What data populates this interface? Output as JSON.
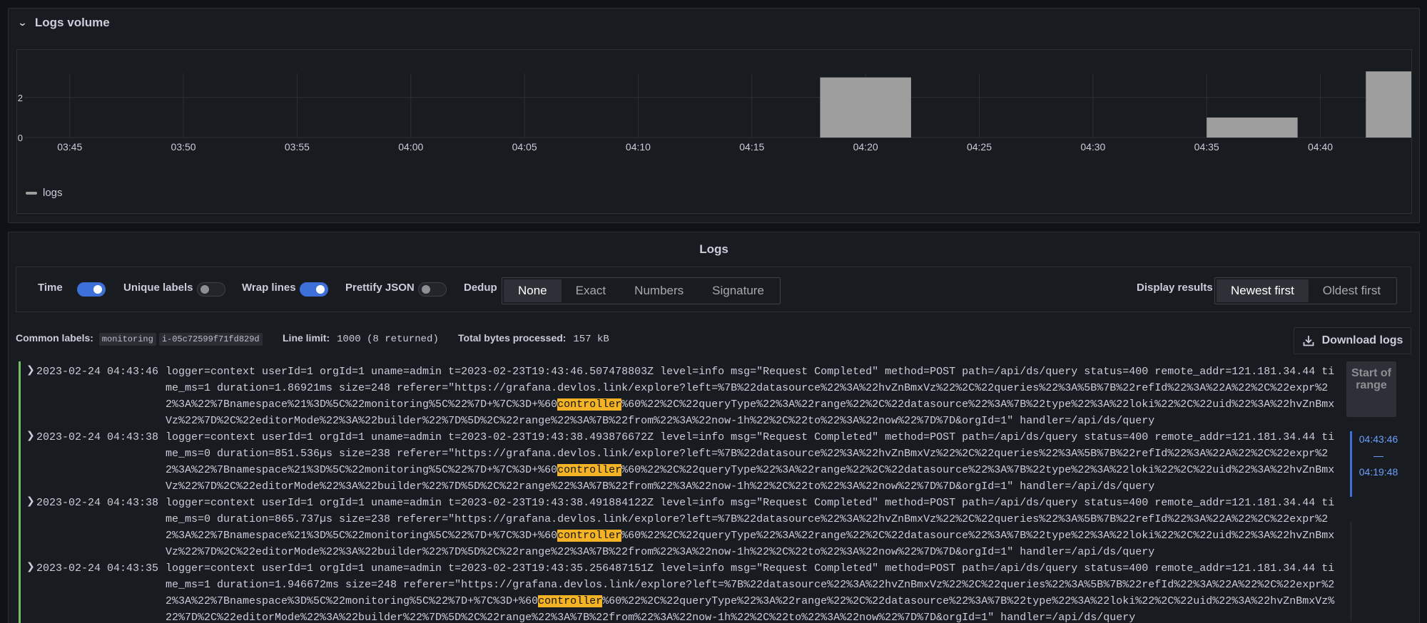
{
  "volume": {
    "title": "Logs volume",
    "legend_label": "logs",
    "series_color": "#9e9e9e"
  },
  "chart_data": {
    "type": "bar",
    "x_ticks": [
      "03:45",
      "03:50",
      "03:55",
      "04:00",
      "04:05",
      "04:10",
      "04:15",
      "04:20",
      "04:25",
      "04:30",
      "04:35",
      "04:40"
    ],
    "y_ticks": [
      "2",
      "0"
    ],
    "ylim": [
      0,
      3.2
    ],
    "xlim_minutes": [
      "03:43",
      "04:44"
    ],
    "series": [
      {
        "name": "logs",
        "points": [
          {
            "start": "04:18",
            "end": "04:22",
            "value": 3
          },
          {
            "start": "04:35",
            "end": "04:39",
            "value": 1
          },
          {
            "start": "04:42",
            "end": "04:44",
            "value": 3.3
          }
        ]
      }
    ],
    "grid": true,
    "legend": "bottom-left"
  },
  "logs": {
    "title": "Logs",
    "options": {
      "time_label": "Time",
      "time_on": true,
      "unique_labels_label": "Unique labels",
      "unique_labels_on": false,
      "wrap_lines_label": "Wrap lines",
      "wrap_lines_on": true,
      "prettify_json_label": "Prettify JSON",
      "prettify_json_on": false,
      "dedup_label": "Dedup",
      "dedup_options": [
        "None",
        "Exact",
        "Numbers",
        "Signature"
      ],
      "dedup_selected": "None",
      "display_results_label": "Display results",
      "order_options": [
        "Newest first",
        "Oldest first"
      ],
      "order_selected": "Newest first"
    },
    "meta": {
      "common_labels_label": "Common labels:",
      "common_labels": [
        "monitoring",
        "i-05c72599f71fd829d"
      ],
      "line_limit_label": "Line limit:",
      "line_limit_value": "1000 (8 returned)",
      "bytes_label": "Total bytes processed:",
      "bytes_value": "157 kB"
    },
    "download_label": "Download logs",
    "range": {
      "start_label": "Start of range",
      "segment_from": "04:43:46",
      "segment_sep": "—",
      "segment_to": "04:19:48"
    },
    "rows": [
      {
        "ts": "2023-02-24 04:43:46",
        "before": "logger=context userId=1 orgId=1 uname=admin t=2023-02-23T19:43:46.507478803Z level=info msg=\"Request Completed\" method=POST path=/api/ds/query status=400 remote_addr=121.181.34.44 time_ms=1 duration=1.86921ms size=248 referer=\"https://grafana.devlos.link/explore?left=%7B%22datasource%22%3A%22hvZnBmxVz%22%2C%22queries%22%3A%5B%7B%22refId%22%3A%22A%22%2C%22expr%22%3A%22%7Bnamespace%21%3D%5C%22monitoring%5C%22%7D+%7C%3D+%60",
        "highlight": "controller",
        "after": "%60%22%2C%22queryType%22%3A%22range%22%2C%22datasource%22%3A%7B%22type%22%3A%22loki%22%2C%22uid%22%3A%22hvZnBmxVz%22%7D%2C%22editorMode%22%3A%22builder%22%7D%5D%2C%22range%22%3A%7B%22from%22%3A%22now-1h%22%2C%22to%22%3A%22now%22%7D%7D&orgId=1\" handler=/api/ds/query"
      },
      {
        "ts": "2023-02-24 04:43:38",
        "before": "logger=context userId=1 orgId=1 uname=admin t=2023-02-23T19:43:38.493876672Z level=info msg=\"Request Completed\" method=POST path=/api/ds/query status=400 remote_addr=121.181.34.44 time_ms=0 duration=851.536µs size=238 referer=\"https://grafana.devlos.link/explore?left=%7B%22datasource%22%3A%22hvZnBmxVz%22%2C%22queries%22%3A%5B%7B%22refId%22%3A%22A%22%2C%22expr%22%3A%22%7Bnamespace%21%3D%5C%22monitoring%5C%22%7D+%7C%3D+%60",
        "highlight": "controller",
        "after": "%60%22%2C%22queryType%22%3A%22range%22%2C%22datasource%22%3A%7B%22type%22%3A%22loki%22%2C%22uid%22%3A%22hvZnBmxVz%22%7D%2C%22editorMode%22%3A%22builder%22%7D%5D%2C%22range%22%3A%7B%22from%22%3A%22now-1h%22%2C%22to%22%3A%22now%22%7D%7D&orgId=1\" handler=/api/ds/query"
      },
      {
        "ts": "2023-02-24 04:43:38",
        "before": "logger=context userId=1 orgId=1 uname=admin t=2023-02-23T19:43:38.491884122Z level=info msg=\"Request Completed\" method=POST path=/api/ds/query status=400 remote_addr=121.181.34.44 time_ms=0 duration=865.737µs size=238 referer=\"https://grafana.devlos.link/explore?left=%7B%22datasource%22%3A%22hvZnBmxVz%22%2C%22queries%22%3A%5B%7B%22refId%22%3A%22A%22%2C%22expr%22%3A%22%7Bnamespace%21%3D%5C%22monitoring%5C%22%7D+%7C%3D+%60",
        "highlight": "controller",
        "after": "%60%22%2C%22queryType%22%3A%22range%22%2C%22datasource%22%3A%7B%22type%22%3A%22loki%22%2C%22uid%22%3A%22hvZnBmxVz%22%7D%2C%22editorMode%22%3A%22builder%22%7D%5D%2C%22range%22%3A%7B%22from%22%3A%22now-1h%22%2C%22to%22%3A%22now%22%7D%7D&orgId=1\" handler=/api/ds/query"
      },
      {
        "ts": "2023-02-24 04:43:35",
        "before": "logger=context userId=1 orgId=1 uname=admin t=2023-02-23T19:43:35.256487151Z level=info msg=\"Request Completed\" method=POST path=/api/ds/query status=400 remote_addr=121.181.34.44 time_ms=1 duration=1.946672ms size=248 referer=\"https://grafana.devlos.link/explore?left=%7B%22datasource%22%3A%22hvZnBmxVz%22%2C%22queries%22%3A%5B%7B%22refId%22%3A%22A%22%2C%22expr%22%3A%22%7Bnamespace%3D%5C%22monitoring%5C%22%7D+%7C%3D+%60",
        "highlight": "controller",
        "after": "%60%22%2C%22queryType%22%3A%22range%22%2C%22datasource%22%3A%7B%22type%22%3A%22loki%22%2C%22uid%22%3A%22hvZnBmxVz%22%7D%2C%22editorMode%22%3A%22builder%22%7D%5D%2C%22range%22%3A%7B%22from%22%3A%22now-1h%22%2C%22to%22%3A%22now%22%7D%7D&orgId=1\" handler=/api/ds/query"
      }
    ]
  }
}
